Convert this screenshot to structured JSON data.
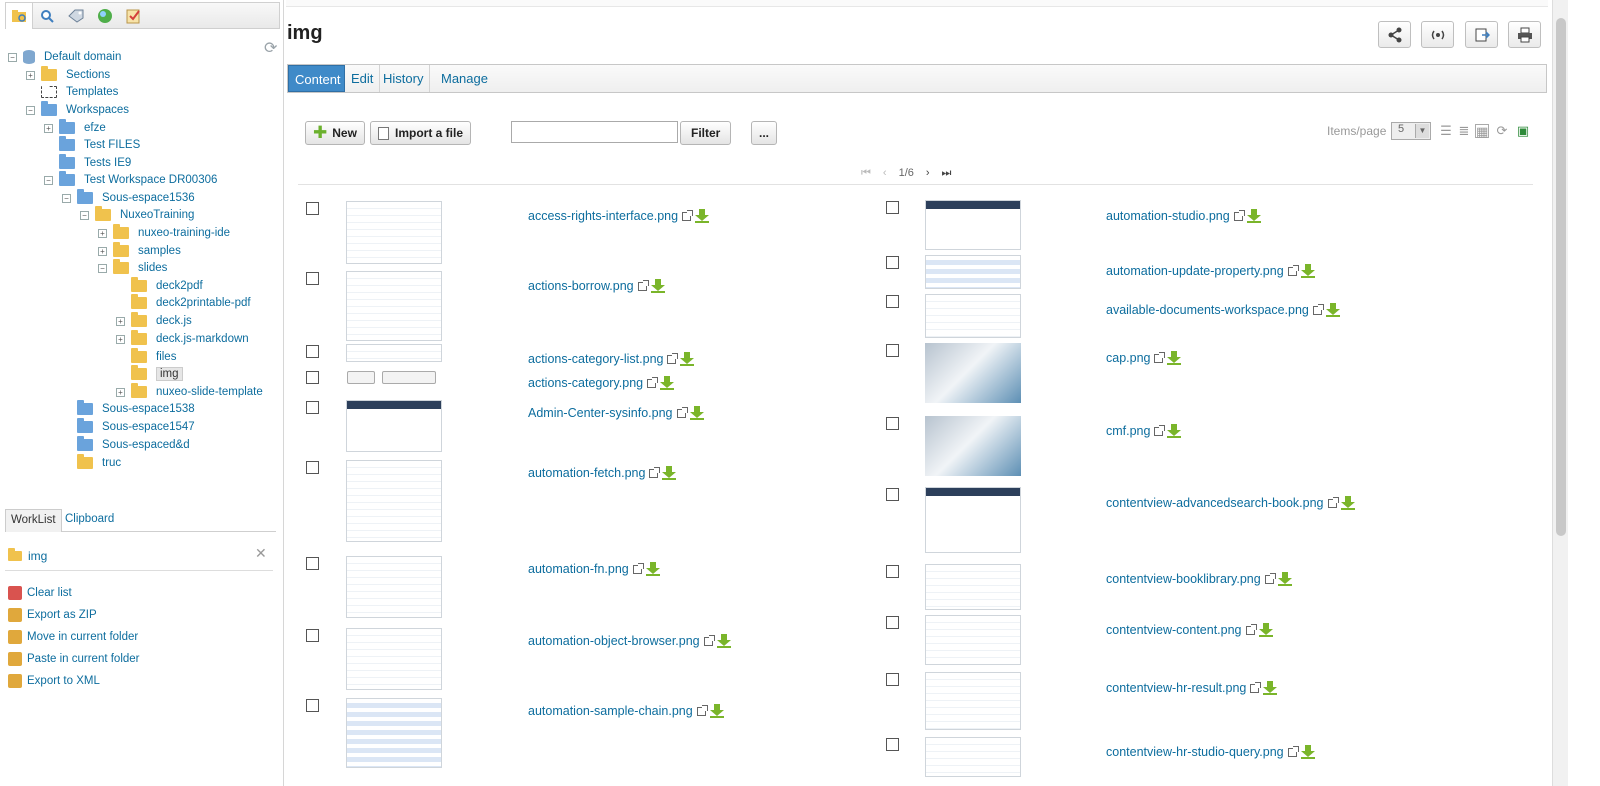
{
  "colors": {
    "link": "#0d6d9e",
    "active_tab": "#3f8ac8",
    "download": "#7ab52a",
    "folder_blue": "#6aa3dc",
    "folder_yellow": "#f0c24d"
  },
  "left_tabs": [
    {
      "icon": "document-browser-icon"
    },
    {
      "icon": "search-icon"
    },
    {
      "icon": "tag-icon"
    },
    {
      "icon": "globe-icon"
    },
    {
      "icon": "tasks-icon"
    }
  ],
  "tree": {
    "nodes": [
      {
        "label": "Default domain",
        "indent": 0,
        "icon": "domain",
        "toggle": "-"
      },
      {
        "label": "Sections",
        "indent": 1,
        "icon": "yellow",
        "toggle": "+"
      },
      {
        "label": "Templates",
        "indent": 1,
        "icon": "template",
        "toggle": ""
      },
      {
        "label": "Workspaces",
        "indent": 1,
        "icon": "blue",
        "toggle": "-"
      },
      {
        "label": "efze",
        "indent": 2,
        "icon": "blue",
        "toggle": "+"
      },
      {
        "label": "Test FILES",
        "indent": 2,
        "icon": "blue",
        "toggle": ""
      },
      {
        "label": "Tests IE9",
        "indent": 2,
        "icon": "blue",
        "toggle": ""
      },
      {
        "label": "Test Workspace DR00306",
        "indent": 2,
        "icon": "blue",
        "toggle": "-"
      },
      {
        "label": "Sous-espace1536",
        "indent": 3,
        "icon": "blue",
        "toggle": "-"
      },
      {
        "label": "NuxeoTraining",
        "indent": 4,
        "icon": "yellow",
        "toggle": "-"
      },
      {
        "label": "nuxeo-training-ide",
        "indent": 5,
        "icon": "yellow",
        "toggle": "+"
      },
      {
        "label": "samples",
        "indent": 5,
        "icon": "yellow",
        "toggle": "+"
      },
      {
        "label": "slides",
        "indent": 5,
        "icon": "yellow",
        "toggle": "-"
      },
      {
        "label": "deck2pdf",
        "indent": 6,
        "icon": "yellow",
        "toggle": ""
      },
      {
        "label": "deck2printable-pdf",
        "indent": 6,
        "icon": "yellow",
        "toggle": ""
      },
      {
        "label": "deck.js",
        "indent": 6,
        "icon": "yellow",
        "toggle": "+"
      },
      {
        "label": "deck.js-markdown",
        "indent": 6,
        "icon": "yellow",
        "toggle": "+"
      },
      {
        "label": "files",
        "indent": 6,
        "icon": "yellow",
        "toggle": ""
      },
      {
        "label": "img",
        "indent": 6,
        "icon": "yellow",
        "toggle": "",
        "selected": true
      },
      {
        "label": "nuxeo-slide-template",
        "indent": 6,
        "icon": "yellow",
        "toggle": "+"
      },
      {
        "label": "Sous-espace1538",
        "indent": 3,
        "icon": "blue",
        "toggle": ""
      },
      {
        "label": "Sous-espace1547",
        "indent": 3,
        "icon": "blue",
        "toggle": ""
      },
      {
        "label": "Sous-espaced&d",
        "indent": 3,
        "icon": "blue",
        "toggle": ""
      },
      {
        "label": "truc",
        "indent": 3,
        "icon": "truc",
        "toggle": ""
      }
    ]
  },
  "worklist": {
    "tabs": [
      "WorkList",
      "Clipboard"
    ],
    "item": "img",
    "actions": [
      "Clear list",
      "Export as ZIP",
      "Move in current folder",
      "Paste in current folder",
      "Export to XML"
    ]
  },
  "header": {
    "title": "img",
    "buttons": [
      "share-icon",
      "subscribe-icon",
      "export-icon",
      "print-icon"
    ]
  },
  "tabs": [
    "Content",
    "Edit",
    "History",
    "Manage"
  ],
  "toolbar": {
    "new_label": "New",
    "import_label": "Import a file",
    "filter_label": "Filter",
    "filter_placeholder": "",
    "more_label": "...",
    "items_per_page_label": "Items/page",
    "items_per_page_value": "5"
  },
  "pager": {
    "text": "1/6"
  },
  "files_left": [
    {
      "name": "access-rights-interface.png",
      "thumb": "doc"
    },
    {
      "name": "actions-borrow.png",
      "thumb": "doc"
    },
    {
      "name": "actions-category-list.png",
      "thumb": "doc"
    },
    {
      "name": "actions-category.png",
      "thumb": "buttons"
    },
    {
      "name": "Admin-Center-sysinfo.png",
      "thumb": "bar"
    },
    {
      "name": "automation-fetch.png",
      "thumb": "doc"
    },
    {
      "name": "automation-fn.png",
      "thumb": "doc"
    },
    {
      "name": "automation-object-browser.png",
      "thumb": "doc"
    },
    {
      "name": "automation-sample-chain.png",
      "thumb": "blue"
    }
  ],
  "files_right": [
    {
      "name": "automation-studio.png",
      "thumb": "bar"
    },
    {
      "name": "automation-update-property.png",
      "thumb": "blue"
    },
    {
      "name": "available-documents-workspace.png",
      "thumb": "doc"
    },
    {
      "name": "cap.png",
      "thumb": "photo"
    },
    {
      "name": "cmf.png",
      "thumb": "photo"
    },
    {
      "name": "contentview-advancedsearch-book.png",
      "thumb": "bar"
    },
    {
      "name": "contentview-booklibrary.png",
      "thumb": "doc"
    },
    {
      "name": "contentview-content.png",
      "thumb": "doc"
    },
    {
      "name": "contentview-hr-result.png",
      "thumb": "doc"
    },
    {
      "name": "contentview-hr-studio-query.png",
      "thumb": "doc"
    }
  ]
}
